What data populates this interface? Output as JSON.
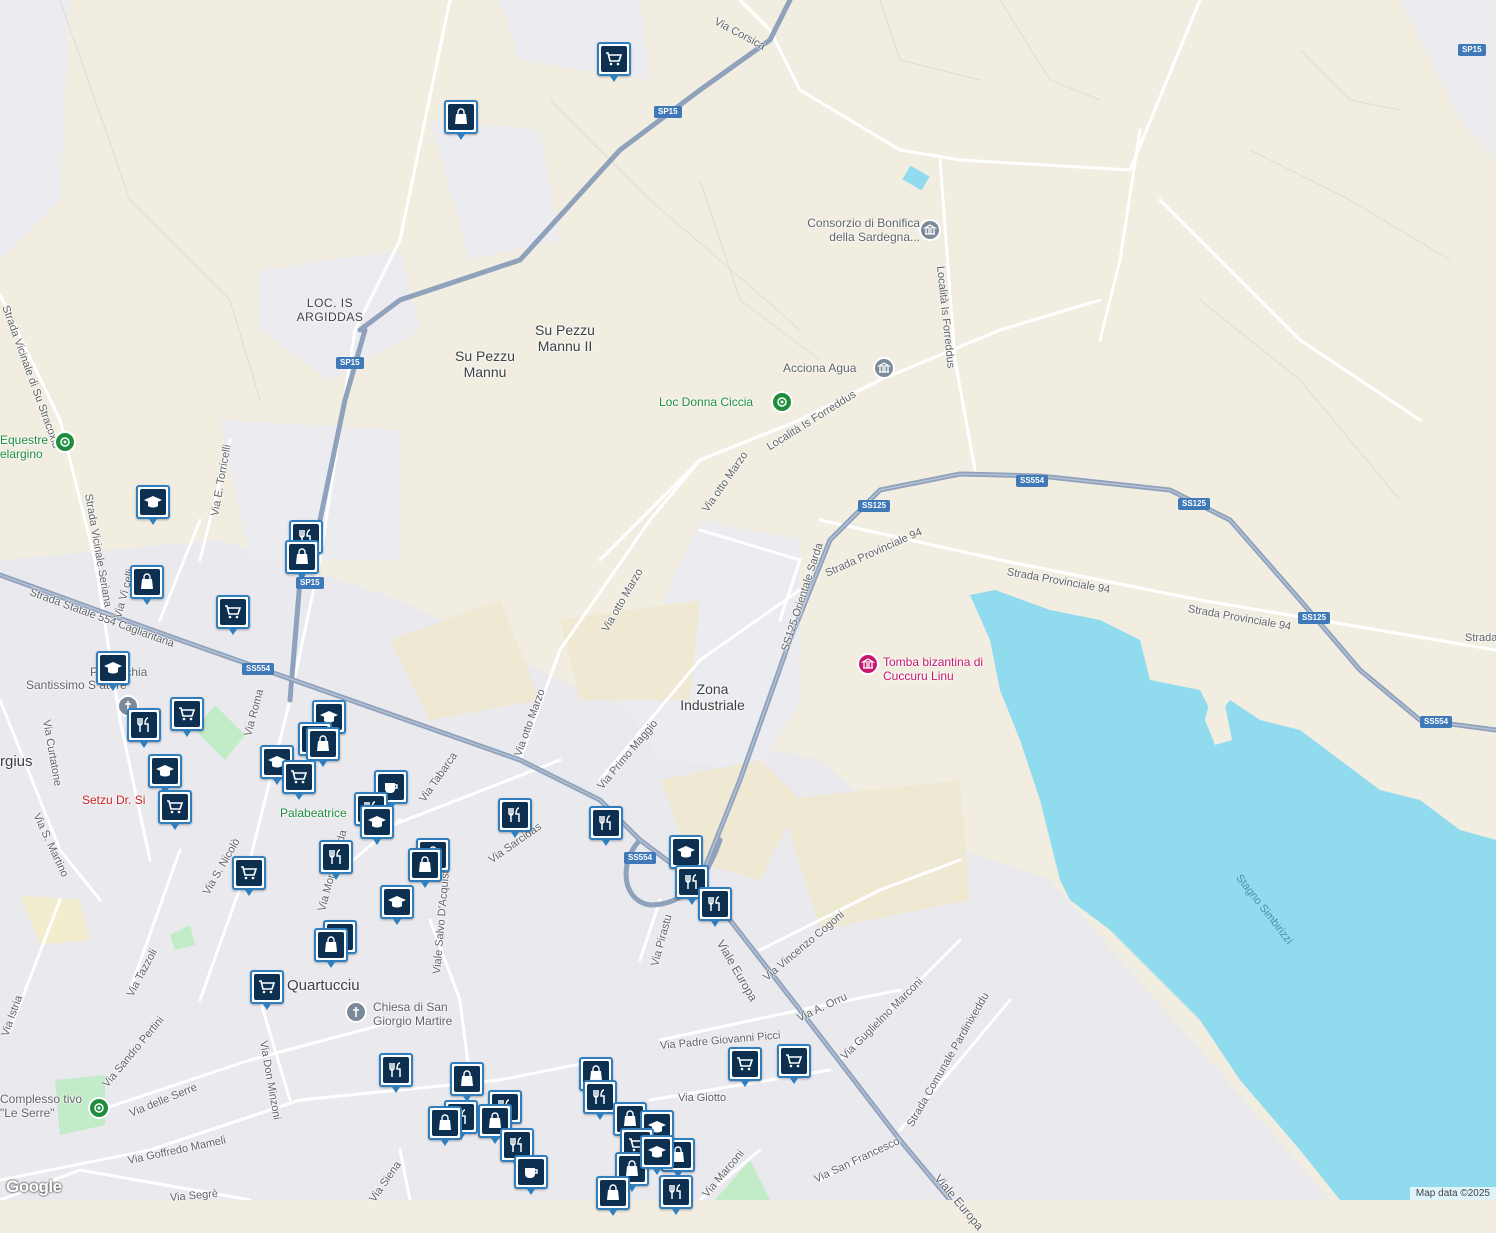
{
  "attribution": "Map data ©2025",
  "logo": "Google",
  "colors": {
    "land": "#f1ede1",
    "urban": "#e8e8ec",
    "water": "#91dbef",
    "road": "#ffffff",
    "highway": "#8fa1bb",
    "park": "#c2ebc7"
  },
  "place_labels": {
    "loc_is_argiddas": "LOC. IS ARGIDDAS",
    "su_pezzu_mannu_ii": "Su Pezzu Mannu II",
    "su_pezzu_mannu": "Su Pezzu Mannu",
    "zona_industriale": "Zona Industriale",
    "quartucciu": "Quartucciu",
    "argius": "rgius"
  },
  "pois": {
    "consorzio": "Consorzio di Bonifica della Sardegna...",
    "acciona": "Acciona Agua",
    "donna_ciccia": "Loc Donna Ciccia",
    "tomba": "Tomba bizantina di Cuccuru Linu",
    "chiesa": "Chiesa di San Giorgio Martire",
    "equestre": "Equestre elargino",
    "palabeatrice": "Palabeatrice",
    "setzu": "Setzu Dr. Si",
    "parrocchia": "Parrocchia",
    "santissimo": "Santissimo S   atore",
    "complesso": "Complesso   tivo \"Le Serre\""
  },
  "water": {
    "stagno": "Stagno Simbirizzi"
  },
  "shields": [
    "SP15",
    "SP15",
    "SP15",
    "SP15",
    "SS125",
    "SS125",
    "SS125",
    "SS554",
    "SS554",
    "SS554",
    "SS554"
  ],
  "streets": [
    "Via Corsica",
    "Località Is Forreddus",
    "Località Is Forreddus",
    "Via otto Marzo",
    "Via otto Marzo",
    "Via otto Marzo",
    "SS125 Orientale Sarda",
    "Strada Provinciale 94",
    "Strada Provinciale 94",
    "Strada Provinciale 94",
    "Strada",
    "Strada Statale 554 Cagliaritana",
    "Via Primo Maggio",
    "Viale Europa",
    "Via Vincenzo Cogoni",
    "Via A. Orru",
    "Via Guglielmo Marconi",
    "Via Padre Giovanni Picci",
    "Via Giotto",
    "Strada Comunale Pardinixeddu",
    "Via San Francesco",
    "Viale Europa",
    "Via Pirastu",
    "Via Marconi",
    "Via delle Serre",
    "Via Goffredo Mameli",
    "Via Segrè",
    "Via Don Minzoni",
    "Viale Salvo D'Acquisto",
    "Via Sandro Pertini",
    "Via Tazzoli",
    "Via Istria",
    "Via S. Martino",
    "Via Curtatone",
    "Via Roma",
    "Via E. Torricelli",
    "Strada Vicinale Seriana",
    "Strada Vicinale di Su Stracoxiu",
    "Via Tabarca",
    "Via S. Nicolò",
    "Via Mons. Spada",
    "Via Siena",
    "Via Sarcidas",
    "Via Vi  celli"
  ],
  "icons": [
    "cart-icon",
    "shopping-bag-icon",
    "restaurant-icon",
    "school-icon",
    "cafe-icon",
    "museum-icon",
    "park-icon",
    "church-icon",
    "medical-icon"
  ]
}
